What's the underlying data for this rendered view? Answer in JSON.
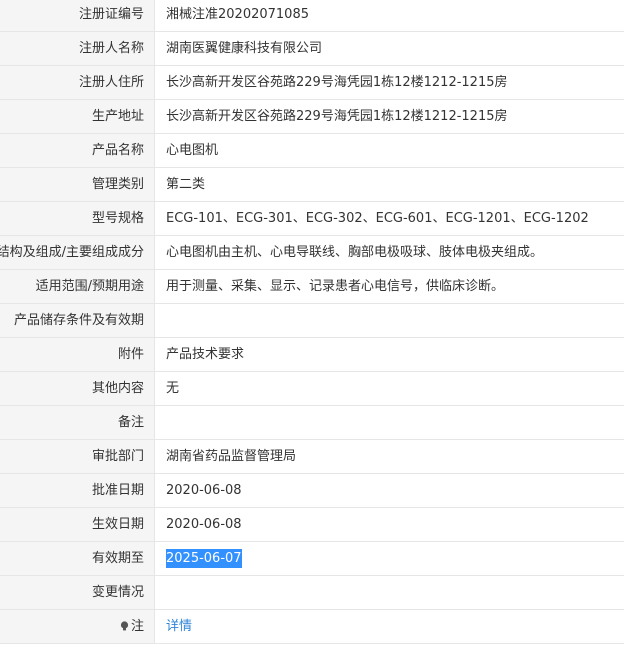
{
  "rows": [
    {
      "label": "注册证编号",
      "value": "湘械注准20202071085"
    },
    {
      "label": "注册人名称",
      "value": "湖南医翼健康科技有限公司"
    },
    {
      "label": "注册人住所",
      "value": "长沙高新开发区谷苑路229号海凭园1栋12楼1212-1215房"
    },
    {
      "label": "生产地址",
      "value": "长沙高新开发区谷苑路229号海凭园1栋12楼1212-1215房"
    },
    {
      "label": "产品名称",
      "value": "心电图机"
    },
    {
      "label": "管理类别",
      "value": "第二类"
    },
    {
      "label": "型号规格",
      "value": "ECG-101、ECG-301、ECG-302、ECG-601、ECG-1201、ECG-1202"
    },
    {
      "label": "结构及组成/主要组成成分",
      "value": "心电图机由主机、心电导联线、胸部电极吸球、肢体电极夹组成。"
    },
    {
      "label": "适用范围/预期用途",
      "value": "用于测量、采集、显示、记录患者心电信号，供临床诊断。"
    },
    {
      "label": "产品储存条件及有效期",
      "value": ""
    },
    {
      "label": "附件",
      "value": "产品技术要求"
    },
    {
      "label": "其他内容",
      "value": "无"
    },
    {
      "label": "备注",
      "value": ""
    },
    {
      "label": "审批部门",
      "value": "湖南省药品监督管理局"
    },
    {
      "label": "批准日期",
      "value": "2020-06-08"
    },
    {
      "label": "生效日期",
      "value": "2020-06-08"
    },
    {
      "label": "有效期至",
      "value": "2025-06-07"
    },
    {
      "label": "变更情况",
      "value": ""
    },
    {
      "label": "注",
      "value": "详情"
    }
  ]
}
